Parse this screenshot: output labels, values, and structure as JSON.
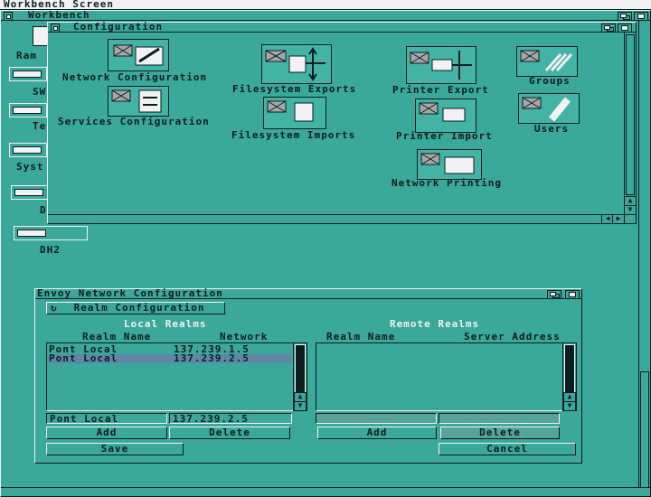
{
  "screen": {
    "title": "Workbench Screen"
  },
  "workbench": {
    "title": "Workbench"
  },
  "backdrop_icons": [
    {
      "label": "Ram"
    },
    {
      "label": "SW"
    },
    {
      "label": "Te"
    },
    {
      "label": "Syst"
    },
    {
      "label": "D"
    },
    {
      "label": "DH2"
    }
  ],
  "config_window": {
    "title": "Configuration",
    "icons": [
      {
        "label": "Network Configuration"
      },
      {
        "label": "Services Configuration"
      },
      {
        "label": "Filesystem Exports"
      },
      {
        "label": "Filesystem Imports"
      },
      {
        "label": "Printer Export"
      },
      {
        "label": "Printer Import"
      },
      {
        "label": "Network Printing"
      },
      {
        "label": "Groups"
      },
      {
        "label": "Users"
      }
    ]
  },
  "envoy": {
    "title": "Envoy Network Configuration",
    "mode_button": "Realm Configuration",
    "local": {
      "heading": "Local Realms",
      "col_name": "Realm Name",
      "col_network": "Network",
      "rows": [
        {
          "name": "Pont Local",
          "network": "137.239.1.5",
          "selected": false
        },
        {
          "name": "Pont Local",
          "network": "137.239.2.5",
          "selected": true
        }
      ],
      "edit_name": "Pont Local",
      "edit_network": "137.239.2.5",
      "add": "Add",
      "delete": "Delete"
    },
    "remote": {
      "heading": "Remote Realms",
      "col_name": "Realm Name",
      "col_address": "Server Address",
      "rows": [],
      "edit_name": "",
      "edit_address": "",
      "add": "Add",
      "delete": "Delete"
    },
    "save": "Save",
    "cancel": "Cancel"
  },
  "colors": {
    "background": "#3aa89a",
    "shadow": "#0d1c1d",
    "shine": "#f2f2f2",
    "selection": "#5f86a6"
  }
}
